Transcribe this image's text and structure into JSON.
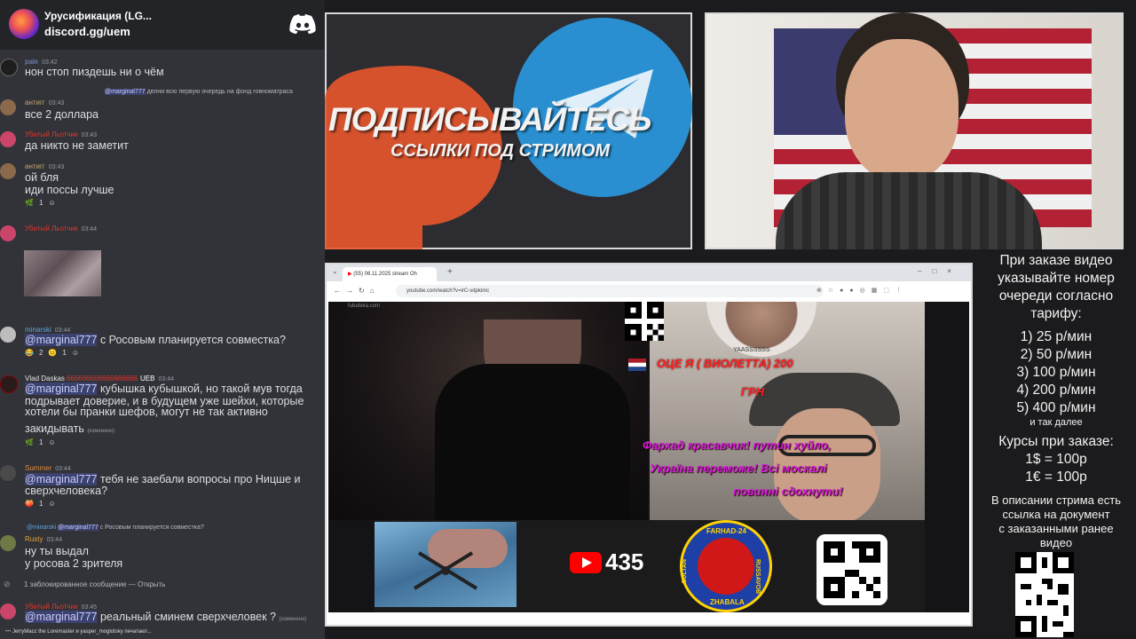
{
  "server": {
    "name": "Урусификация (LG...",
    "invite": "discord.gg/uem"
  },
  "messages": [
    {
      "user": "pale",
      "user_color": "#7c8bd6",
      "time": "03:42",
      "text": "нон стоп пиздешь ни о чём"
    },
    {
      "reply_mention": "@marginal777",
      "reply_text": "делни всю первую очередь на фонд говноматраса",
      "user": "антигг",
      "user_color": "#c9a86a",
      "time": "03:43",
      "text": "все 2 доллара"
    },
    {
      "user": "Убитый Льотчик",
      "user_color": "#e0352f",
      "time": "03:43",
      "text": "да никто не заметит"
    },
    {
      "user": "антигг",
      "user_color": "#c9a86a",
      "time": "03:43",
      "line1": "ой бля",
      "line2": "иди поссы лучше",
      "reaction": "1"
    },
    {
      "user": "Убитый Льотчик",
      "user_color": "#e0352f",
      "time": "03:44"
    },
    {
      "user": "minarski",
      "user_color": "#5fa4e0",
      "time": "03:44",
      "mention": "@marginal777",
      "text": " с Росовым планируется совместка?",
      "reactions": [
        "2",
        "1"
      ]
    },
    {
      "user": "Vlad Daskas",
      "user_name_suffix": "666666666666666666",
      "user_color": "#e4e4e4",
      "badge": "UEB",
      "time": "03:44",
      "mention": "@marginal777",
      "text": " кубышка кубышкой, но такой мув тогда",
      "line2": "подрывает доверие, и в будущем уже шейхи, которые",
      "line3": "хотели бы пранки шефов, могут не так активно",
      "line4": "закидывать",
      "edited": "(изменено)",
      "reaction": "1"
    },
    {
      "user": "Summer",
      "user_color": "#e08a3c",
      "time": "03:44",
      "mention": "@marginal777",
      "text": " тебя не заебали вопросы про Ницше и",
      "line2": "сверхчеловека?",
      "reaction": "1"
    },
    {
      "reply_user": "@minarski",
      "reply_mention": "@marginal777",
      "reply_text": "с Росовым планируется совместка?",
      "user": "Rusty",
      "user_color": "#e0a33a",
      "time": "03:44",
      "line1": "ну ты выдал",
      "line2": "у росова 2 зрителя"
    },
    {
      "blocked": "1 заблокированное сообщение — Открыть"
    },
    {
      "user": "Убитый Льотчик",
      "user_color": "#e0352f",
      "time": "03:45",
      "mention": "@marginal777",
      "text": " реальный сминем сверхчеловек ?",
      "edited": "(изменено)"
    }
  ],
  "typing": "JerryMacc the Loremaster и yasper_moglotsky печатают...",
  "banner": {
    "title": "ПОДПИСЫВАЙТЕСЬ",
    "subtitle": "ССЫЛКИ ПОД СТРИМОМ"
  },
  "browser": {
    "tab_title": "(55) 06.11.2025 stream Oh",
    "url": "youtube.com/watch?v=lrC-vdpkimc",
    "overlay_watermark": "fubafeka.com"
  },
  "video": {
    "kim_tag": "YAASSSSSS",
    "donate_amount": "ОЦЕ Я ( ВИОЛЕТТА) 200",
    "donate_currency": "ГРН",
    "donate_msg_1": "Фархад красавчик! путин хуйло,",
    "donate_msg_2": "Україна переможе! Всі москалі",
    "donate_msg_3": "повинні сдохнути!",
    "viewers": "435",
    "logo_top": "FARHAD-24",
    "logo_left": "SULTAN",
    "logo_right": "RUSSAVOB",
    "logo_bottom": "ZHABALA"
  },
  "info": {
    "intro": [
      "При заказе видео",
      "указывайте номер",
      "очереди согласно",
      "тарифу:"
    ],
    "tariffs": [
      "1) 25 р/мин",
      "2) 50 р/мин",
      "3) 100 р/мин",
      "4) 200 р/мин",
      "5) 400 р/мин"
    ],
    "and_more": "и так далее",
    "rates_title": "Курсы при заказе:",
    "rates": [
      "1$ = 100р",
      "1€ = 100р"
    ],
    "doc_note": [
      "В описании стрима есть",
      "ссылка на документ",
      "с заказанными ранее",
      "видео"
    ]
  },
  "colors": {
    "discord_bg": "#313338",
    "mention_bg": "#3c4270",
    "telegram_blue": "#2a8fd0",
    "patreon_orange": "#e8562e",
    "donate_purple": "#d21ad8",
    "donate_red": "#ff2020"
  }
}
